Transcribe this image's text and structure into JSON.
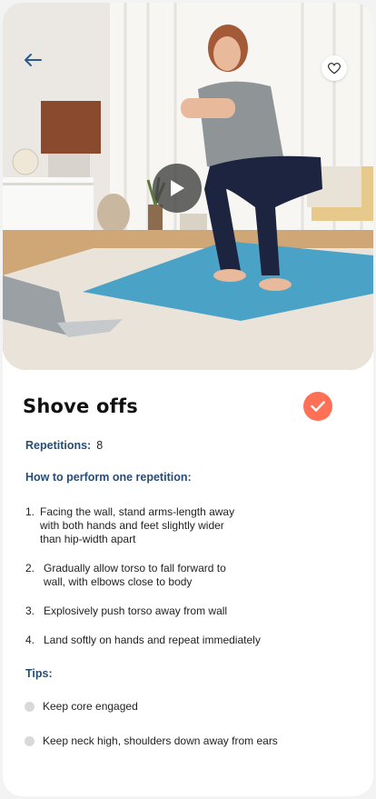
{
  "exercise": {
    "title": "Shove offs",
    "repetitions_label": "Repetitions:",
    "repetitions_value": "8",
    "how_to_heading": "How to perform one repetition:",
    "steps": [
      {
        "num": "1.",
        "lines": [
          "Facing the wall, stand arms-length away",
          "with both hands and feet slightly wider",
          "than hip-width apart"
        ]
      },
      {
        "num": "2.",
        "lines": [
          "Gradually allow torso to fall forward to",
          "wall, with elbows close to body"
        ]
      },
      {
        "num": "3.",
        "lines": [
          "Explosively push torso away from wall"
        ]
      },
      {
        "num": "4.",
        "lines": [
          "Land softly on hands and repeat immediately"
        ]
      }
    ],
    "tips_heading": "Tips:",
    "tips": [
      "Keep core engaged",
      "Keep neck high, shoulders down away from ears"
    ]
  },
  "icons": {
    "back": "arrow-left-icon",
    "favorite": "heart-icon",
    "play": "play-icon",
    "complete": "check-icon"
  },
  "colors": {
    "accent": "#ff7057",
    "heading": "#274d77",
    "back_arrow": "#2b5a8c",
    "mat": "#4aa3c6"
  }
}
